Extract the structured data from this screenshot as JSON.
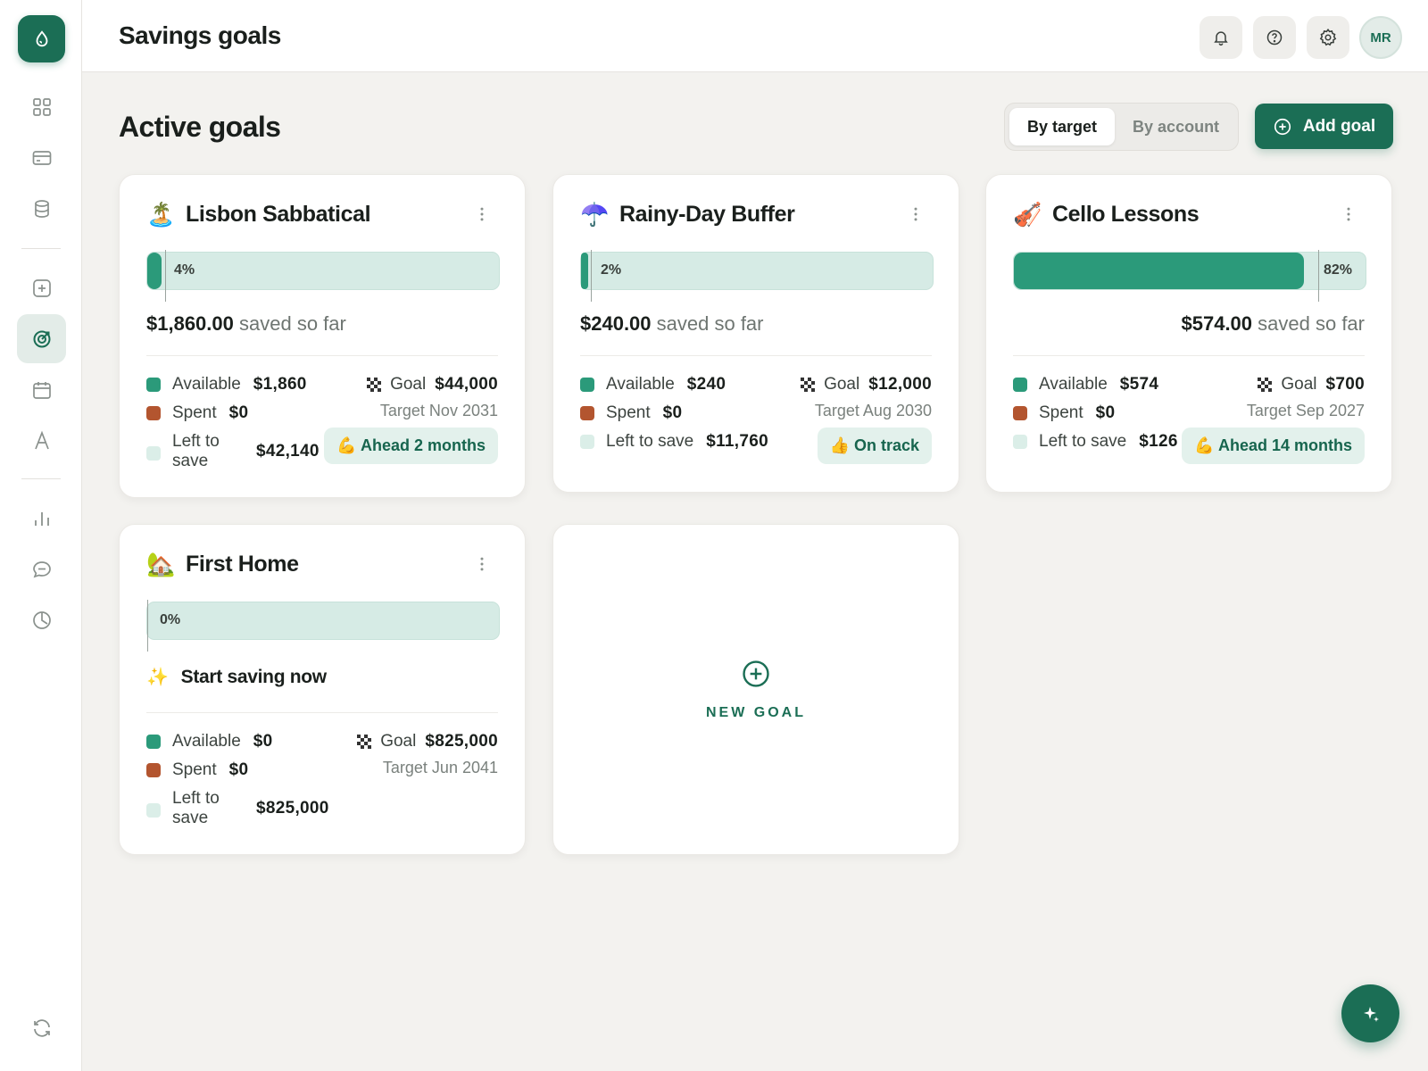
{
  "header": {
    "title": "Savings goals",
    "avatar_initials": "MR"
  },
  "section": {
    "title": "Active goals"
  },
  "toggle": {
    "options": [
      "By target",
      "By account"
    ],
    "selected": "By target"
  },
  "add_goal_label": "Add goal",
  "colors": {
    "accent": "#1b6e55",
    "available": "#2b9a7a",
    "spent": "#b3552f",
    "left": "#dbeee8"
  },
  "legend_labels": {
    "available": "Available",
    "spent": "Spent",
    "left": "Left to save",
    "goal": "Goal"
  },
  "goals": [
    {
      "emoji": "🏝️",
      "name": "Lisbon Sabbatical",
      "percent_label": "4%",
      "progress": 0.04,
      "saved_amount": "$1,860.00",
      "saved_suffix": "saved so far",
      "available": "$1,860",
      "spent": "$0",
      "left": "$42,140",
      "goal": "$44,000",
      "target": "Target Nov 2031",
      "badge": "💪 Ahead 2 months"
    },
    {
      "emoji": "☂️",
      "name": "Rainy-Day Buffer",
      "percent_label": "2%",
      "progress": 0.02,
      "saved_amount": "$240.00",
      "saved_suffix": "saved so far",
      "available": "$240",
      "spent": "$0",
      "left": "$11,760",
      "goal": "$12,000",
      "target": "Target Aug 2030",
      "badge": "👍 On track"
    },
    {
      "emoji": "🎻",
      "name": "Cello Lessons",
      "percent_label": "82%",
      "progress": 0.82,
      "saved_amount": "$574.00",
      "saved_suffix": "saved so far",
      "available": "$574",
      "spent": "$0",
      "left": "$126",
      "goal": "$700",
      "target": "Target Sep 2027",
      "badge": "💪 Ahead 14 months"
    },
    {
      "emoji": "🏡",
      "name": "First Home",
      "percent_label": "0%",
      "progress": 0,
      "start_label": "Start saving now",
      "start_emoji": "✨",
      "available": "$0",
      "spent": "$0",
      "left": "$825,000",
      "goal": "$825,000",
      "target": "Target Jun 2041"
    }
  ],
  "new_goal_label": "NEW GOAL",
  "icons": {
    "sidebar": [
      "logo-drop-icon",
      "dashboard-grid-icon",
      "credit-card-icon",
      "database-icon",
      "add-square-icon",
      "target-icon",
      "calendar-icon",
      "font-a-icon",
      "bar-chart-icon",
      "chat-icon",
      "clock-icon",
      "sync-icon"
    ],
    "topbar": [
      "bell-icon",
      "help-icon",
      "gear-icon"
    ],
    "fab": "sparkle-icon"
  }
}
